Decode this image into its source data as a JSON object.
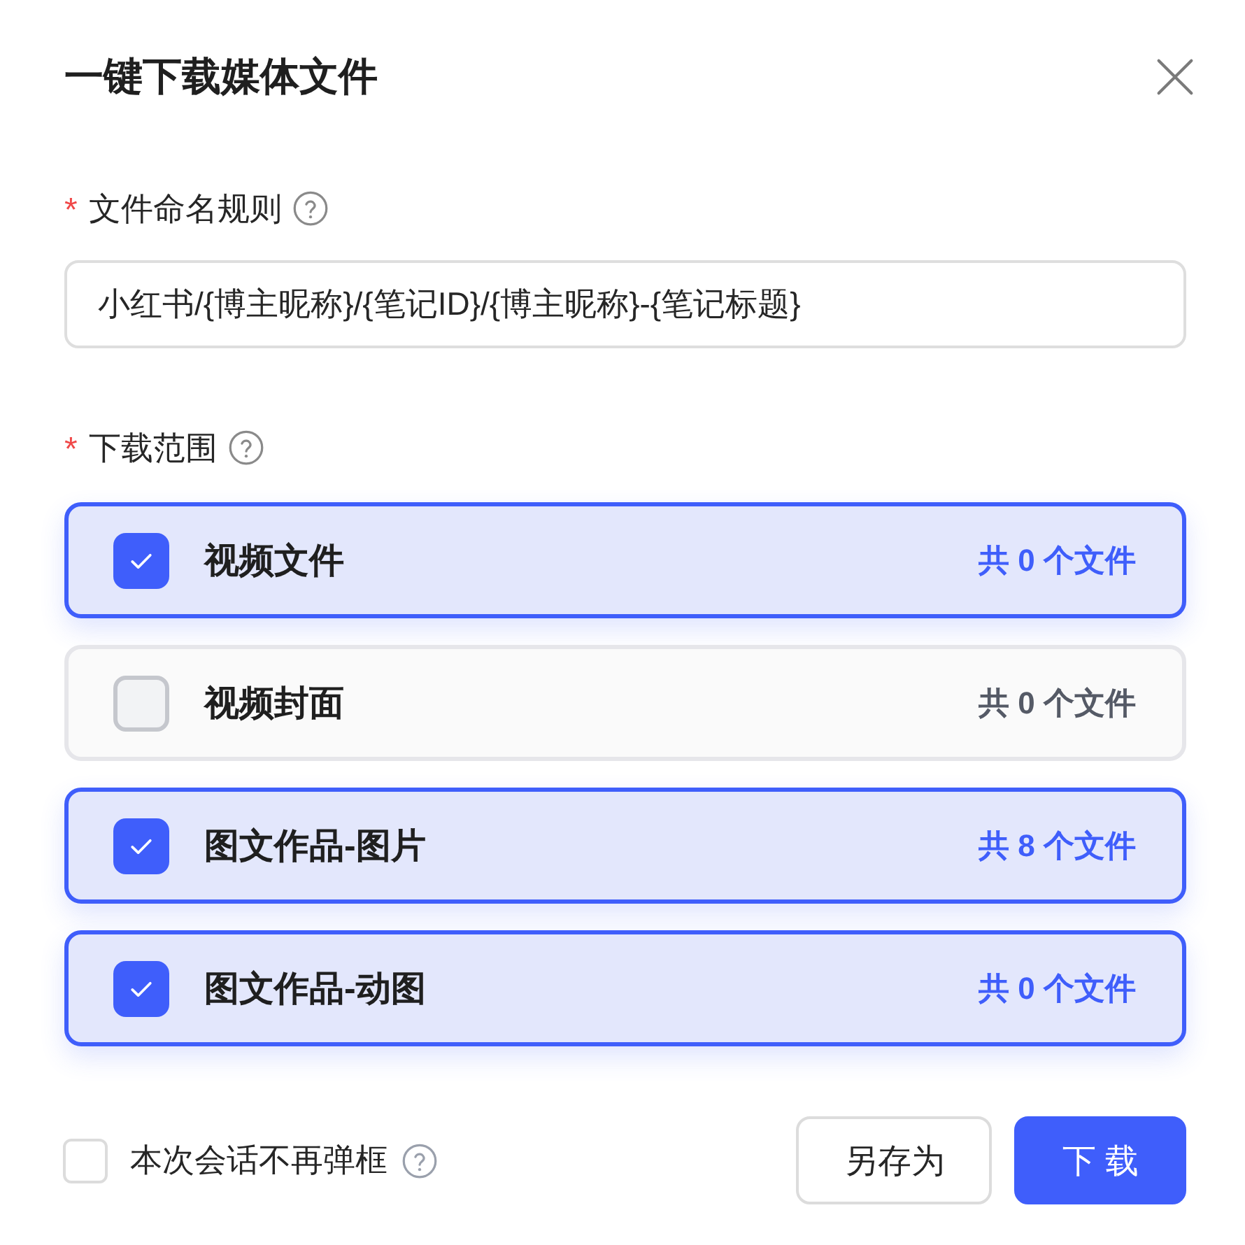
{
  "dialog": {
    "title": "一键下载媒体文件"
  },
  "naming_rule": {
    "required_mark": "*",
    "label": "文件命名规则",
    "value": "小红书/{博主昵称}/{笔记ID}/{博主昵称}-{笔记标题}"
  },
  "download_scope": {
    "required_mark": "*",
    "label": "下载范围",
    "options": [
      {
        "label": "视频文件",
        "count": "共 0 个文件",
        "checked": true
      },
      {
        "label": "视频封面",
        "count": "共 0 个文件",
        "checked": false
      },
      {
        "label": "图文作品-图片",
        "count": "共 8 个文件",
        "checked": true
      },
      {
        "label": "图文作品-动图",
        "count": "共 0 个文件",
        "checked": true
      }
    ]
  },
  "footer": {
    "dont_ask_again": {
      "label": "本次会话不再弹框",
      "checked": false
    },
    "buttons": [
      {
        "label": "另存为",
        "kind": "secondary"
      },
      {
        "label": "下 载",
        "kind": "primary"
      }
    ]
  }
}
